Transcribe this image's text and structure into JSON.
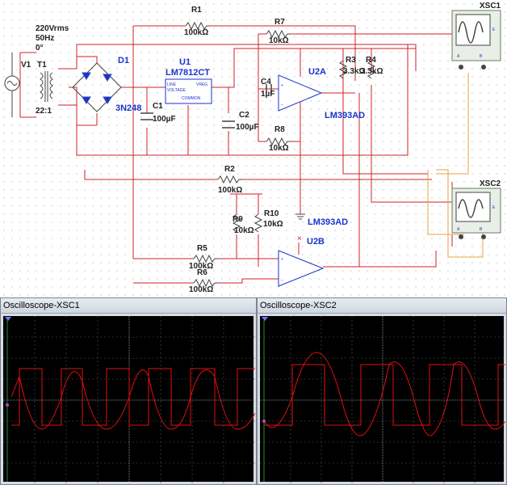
{
  "source": {
    "voltage": "220Vrms",
    "frequency": "50Hz",
    "phase": "0°",
    "name": "V1"
  },
  "transformer": {
    "name": "T1",
    "ratio": "22:1"
  },
  "bridge": {
    "name": "D1",
    "part": "3N248"
  },
  "regulator": {
    "name": "U1",
    "part": "LM7812CT",
    "pin_line": "LINE",
    "pin_voltage": "VOLTAGE",
    "pin_vreg": "VREG",
    "pin_common": "COMMON"
  },
  "capacitors": [
    {
      "name": "C1",
      "value": "100µF"
    },
    {
      "name": "C2",
      "value": "100µF"
    },
    {
      "name": "C4",
      "value": "1µF"
    }
  ],
  "resistors": [
    {
      "name": "R1",
      "value": "100kΩ"
    },
    {
      "name": "R7",
      "value": "10kΩ"
    },
    {
      "name": "R3",
      "value": "3.3kΩ"
    },
    {
      "name": "R4",
      "value": "3.3kΩ"
    },
    {
      "name": "R8",
      "value": "10kΩ"
    },
    {
      "name": "R2",
      "value": "100kΩ"
    },
    {
      "name": "R9",
      "value": "10kΩ"
    },
    {
      "name": "R10",
      "value": "10kΩ"
    },
    {
      "name": "R5",
      "value": "100kΩ"
    },
    {
      "name": "R6",
      "value": "100kΩ"
    }
  ],
  "opamps": [
    {
      "name": "U2A",
      "part": "LM393AD"
    },
    {
      "name": "U2B",
      "part": "LM393AD"
    }
  ],
  "scopes": [
    {
      "name": "XSC1",
      "window_title": "Oscilloscope-XSC1",
      "pin_a": "A",
      "pin_b": "B",
      "pin_ext": "E"
    },
    {
      "name": "XSC2",
      "window_title": "Oscilloscope-XSC2",
      "pin_a": "A",
      "pin_b": "B",
      "pin_ext": "E"
    }
  ],
  "colors": {
    "wire": "#d0202a",
    "label_blue": "#1a33cc",
    "scope_trace": "#e01010",
    "probe_orange": "#e8a040"
  }
}
